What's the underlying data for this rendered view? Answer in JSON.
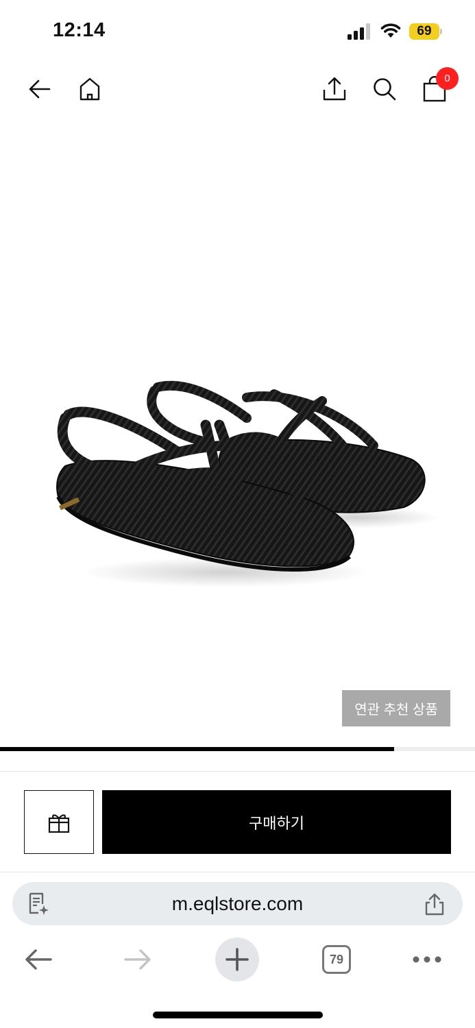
{
  "status_bar": {
    "time": "12:14",
    "battery_level": "69",
    "signal_bars": 3,
    "battery_color": "#f2cf1f"
  },
  "header": {
    "back_icon": "arrow-left-icon",
    "home_icon": "home-icon",
    "share_icon": "share-icon",
    "search_icon": "search-icon",
    "cart_icon": "shopping-bag-icon",
    "cart_count": "0",
    "badge_color": "#ff1f1f"
  },
  "product": {
    "image_description_icon": "black-rope-sandals",
    "related_button_label": "연관 추천 상품",
    "gallery_progress": 0.83
  },
  "actions": {
    "gift_icon": "gift-icon",
    "buy_label": "구매하기"
  },
  "browser": {
    "url": "m.eqlstore.com",
    "reader_icon": "reader-icon",
    "share_icon": "share-icon",
    "back_icon": "arrow-left-icon",
    "forward_icon": "arrow-right-icon",
    "new_tab_icon": "plus-icon",
    "tab_count": "79",
    "more_icon": "more-dots-icon"
  }
}
